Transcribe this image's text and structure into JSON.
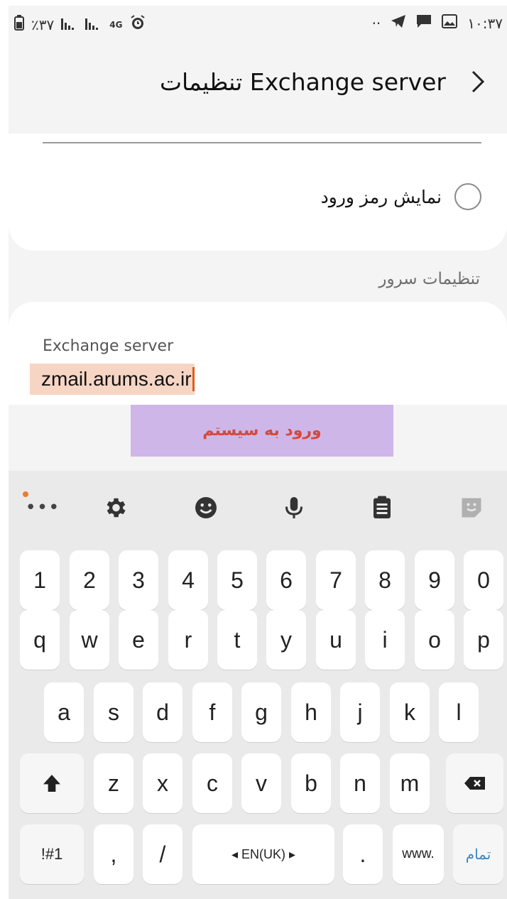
{
  "status_bar": {
    "left_text": "٪۳۷",
    "network": "4G",
    "time": "۱۰:۳۷",
    "dots": "··"
  },
  "header": {
    "title": "تنظیمات Exchange server"
  },
  "options": {
    "show_password_label": "نمایش رمز ورود",
    "show_password_checked": false
  },
  "server_settings": {
    "section_title": "تنظیمات سرور",
    "field_label": "Exchange server",
    "field_value": "zmail.arums.ac.ir"
  },
  "login_button": {
    "label": "ورود به سیستم"
  },
  "keyboard": {
    "number_row": [
      "1",
      "2",
      "3",
      "4",
      "5",
      "6",
      "7",
      "8",
      "9",
      "0"
    ],
    "row1": [
      "q",
      "w",
      "e",
      "r",
      "t",
      "y",
      "u",
      "i",
      "o",
      "p"
    ],
    "row2": [
      "a",
      "s",
      "d",
      "f",
      "g",
      "h",
      "j",
      "k",
      "l"
    ],
    "row3": [
      "z",
      "x",
      "c",
      "v",
      "b",
      "n",
      "m"
    ],
    "symbols_key": "!#1",
    "comma_key": ",",
    "slash_key": "/",
    "space_label": "◂ EN(UK) ▸",
    "period_key": ".",
    "www_key": "www.",
    "done_key": "تمام"
  },
  "colors": {
    "accent_orange": "#e25c1b",
    "highlight": "#f7d5c4",
    "login_bg": "#cfb6e8",
    "login_text": "#d44a3a",
    "done_text": "#3a86c8"
  }
}
